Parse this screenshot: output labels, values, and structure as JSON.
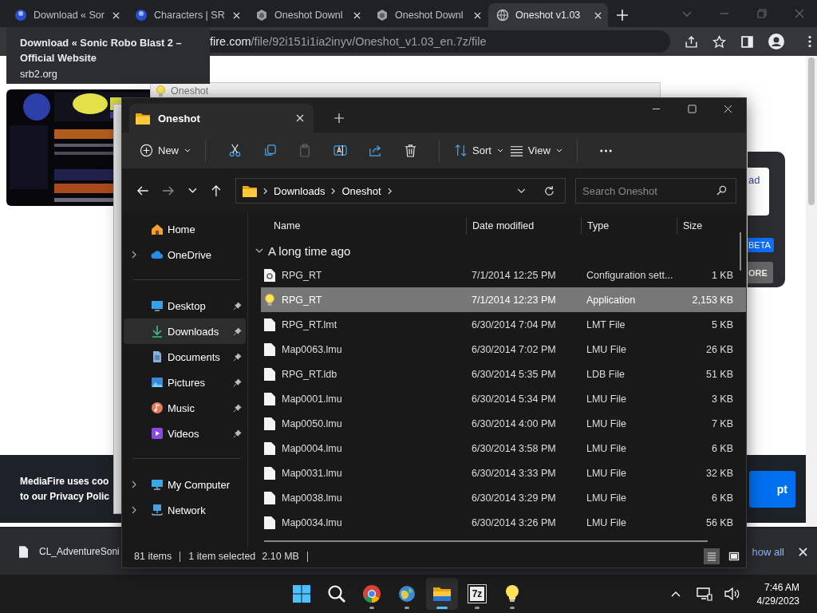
{
  "browser": {
    "tabs": [
      {
        "title": "Download « Sor",
        "kind": "avatar",
        "selected": false
      },
      {
        "title": "Characters | SR",
        "kind": "avatar",
        "selected": false
      },
      {
        "title": "Oneshot Downl",
        "kind": "hexagon",
        "selected": false
      },
      {
        "title": "Oneshot Downl",
        "kind": "hexagon",
        "selected": false
      },
      {
        "title": "Oneshot v1.03",
        "kind": "globe",
        "selected": true
      }
    ],
    "url_host": "fire.com",
    "url_path": "/file/92i151i1ia2inyv/Oneshot_v1.03_en.7z/file",
    "tooltip": {
      "title": "Download « Sonic Robo Blast 2 – Official Website",
      "domain": "srb2.org"
    },
    "card": {
      "link": "ad",
      "badge": "BETA",
      "button": "ORE"
    },
    "cookie_banner": {
      "line_1": "MediaFire uses coo",
      "line_2": "to our Privacy Polic",
      "button": "pt"
    },
    "download": {
      "file": "CL_AdventureSoni",
      "show_all": "how all"
    }
  },
  "rpg_window": {
    "title": "Oneshot"
  },
  "explorer": {
    "tab_title": "Oneshot",
    "toolbar": [
      {
        "kind": "new",
        "label": "New",
        "disabled": false
      },
      {
        "kind": "cut",
        "disabled": false
      },
      {
        "kind": "copy",
        "disabled": false
      },
      {
        "kind": "paste",
        "disabled": true
      },
      {
        "kind": "rename",
        "disabled": false
      },
      {
        "kind": "share",
        "disabled": false
      },
      {
        "kind": "delete",
        "disabled": false
      },
      {
        "kind": "sort",
        "label": "Sort",
        "disabled": false
      },
      {
        "kind": "view",
        "label": "View",
        "disabled": false
      },
      {
        "kind": "more",
        "disabled": false
      }
    ],
    "breadcrumb": [
      "Downloads",
      "Oneshot"
    ],
    "search": {
      "placeholder": "Search Oneshot"
    },
    "nav_sections": [
      [
        {
          "label": "Home",
          "kind": "home",
          "expandable": false,
          "pinned": false,
          "selected": false
        },
        {
          "label": "OneDrive",
          "kind": "cloud",
          "expandable": true,
          "pinned": false,
          "selected": false
        }
      ],
      [
        {
          "label": "Desktop",
          "kind": "desktop",
          "expandable": false,
          "pinned": true,
          "selected": false
        },
        {
          "label": "Downloads",
          "kind": "download",
          "expandable": false,
          "pinned": true,
          "selected": true
        },
        {
          "label": "Documents",
          "kind": "document",
          "expandable": false,
          "pinned": true,
          "selected": false
        },
        {
          "label": "Pictures",
          "kind": "picture",
          "expandable": false,
          "pinned": true,
          "selected": false
        },
        {
          "label": "Music",
          "kind": "music",
          "expandable": false,
          "pinned": true,
          "selected": false
        },
        {
          "label": "Videos",
          "kind": "video",
          "expandable": false,
          "pinned": true,
          "selected": false
        }
      ],
      [
        {
          "label": "My Computer",
          "kind": "computer",
          "expandable": true,
          "pinned": false,
          "selected": false
        },
        {
          "label": "Network",
          "kind": "network",
          "expandable": true,
          "pinned": false,
          "selected": false
        }
      ]
    ],
    "columns": [
      "Name",
      "Date modified",
      "Type",
      "Size"
    ],
    "group": {
      "label": "A long time ago",
      "expanded": true
    },
    "files": [
      {
        "name": "RPG_RT",
        "modified": "7/1/2014 12:25 PM",
        "type": "Configuration sett...",
        "size": "1 KB",
        "kind": "config",
        "selected": false
      },
      {
        "name": "RPG_RT",
        "modified": "7/1/2014 12:23 PM",
        "type": "Application",
        "size": "2,153 KB",
        "kind": "app",
        "selected": true
      },
      {
        "name": "RPG_RT.lmt",
        "modified": "6/30/2014 7:04 PM",
        "type": "LMT File",
        "size": "5 KB",
        "kind": "file",
        "selected": false
      },
      {
        "name": "Map0063.lmu",
        "modified": "6/30/2014 7:02 PM",
        "type": "LMU File",
        "size": "26 KB",
        "kind": "file",
        "selected": false
      },
      {
        "name": "RPG_RT.ldb",
        "modified": "6/30/2014 5:35 PM",
        "type": "LDB File",
        "size": "51 KB",
        "kind": "file",
        "selected": false
      },
      {
        "name": "Map0001.lmu",
        "modified": "6/30/2014 5:34 PM",
        "type": "LMU File",
        "size": "3 KB",
        "kind": "file",
        "selected": false
      },
      {
        "name": "Map0050.lmu",
        "modified": "6/30/2014 4:00 PM",
        "type": "LMU File",
        "size": "7 KB",
        "kind": "file",
        "selected": false
      },
      {
        "name": "Map0004.lmu",
        "modified": "6/30/2014 3:58 PM",
        "type": "LMU File",
        "size": "6 KB",
        "kind": "file",
        "selected": false
      },
      {
        "name": "Map0031.lmu",
        "modified": "6/30/2014 3:33 PM",
        "type": "LMU File",
        "size": "32 KB",
        "kind": "file",
        "selected": false
      },
      {
        "name": "Map0038.lmu",
        "modified": "6/30/2014 3:29 PM",
        "type": "LMU File",
        "size": "6 KB",
        "kind": "file",
        "selected": false
      },
      {
        "name": "Map0034.lmu",
        "modified": "6/30/2014 3:26 PM",
        "type": "LMU File",
        "size": "56 KB",
        "kind": "file",
        "selected": false
      }
    ],
    "status": {
      "count": "81 items",
      "selection": "1 item selected",
      "size": "2.10 MB"
    },
    "view_buttons": [
      {
        "kind": "details",
        "selected": true
      },
      {
        "kind": "tiles",
        "selected": false
      }
    ]
  },
  "taskbar": {
    "apps": [
      {
        "kind": "start",
        "running": false,
        "active": false
      },
      {
        "kind": "search",
        "running": false,
        "active": false
      },
      {
        "kind": "browser",
        "running": true,
        "active": false
      },
      {
        "kind": "globe",
        "running": true,
        "active": false
      },
      {
        "kind": "folder",
        "running": true,
        "active": true
      },
      {
        "kind": "archiver",
        "label": "7z",
        "running": true,
        "active": false
      },
      {
        "kind": "bulb",
        "running": true,
        "active": false
      }
    ],
    "time": "7:46 AM",
    "date": "4/29/2023"
  }
}
